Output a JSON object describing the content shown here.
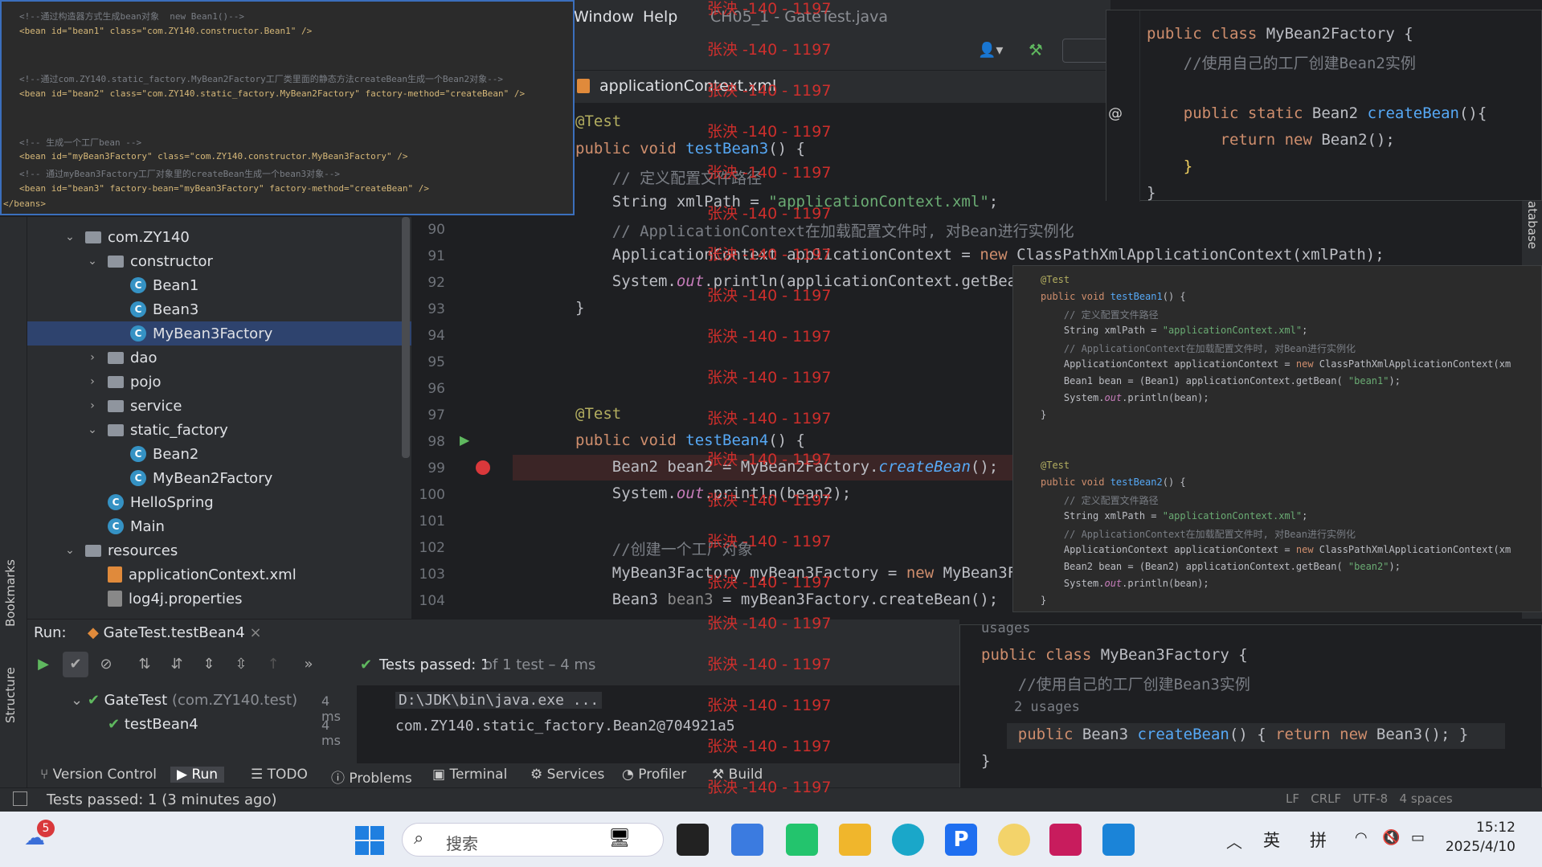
{
  "menubar": {
    "window": "Window",
    "help": "Help",
    "title": "CH05_1 - GateTest.java"
  },
  "editor_tab": {
    "label": "applicationContext.xml"
  },
  "watermark": "张泱 -140 - 1197",
  "xml_popup": {
    "lines": [
      "<!--通过构造器方式生成bean对象  new Bean1()-->",
      "<bean id=\"bean1\" class=\"com.ZY140.constructor.Bean1\" />",
      "",
      "",
      "<!--通过com.ZY140.static_factory.MyBean2Factory工厂类里面的静态方法createBean生成一个Bean2对象-->",
      "<bean id=\"bean2\" class=\"com.ZY140.static_factory.MyBean2Factory\" factory-method=\"createBean\" />",
      "",
      "",
      "<!-- 生成一个工厂bean -->",
      "<bean id=\"myBean3Factory\" class=\"com.ZY140.constructor.MyBean3Factory\" />",
      "<!-- 通过myBean3Factory工厂对象里的createBean生成一个bean3对象-->",
      "<bean id=\"bean3\" factory-bean=\"myBean3Factory\" factory-method=\"createBean\" />",
      "</beans>"
    ]
  },
  "project_tree": [
    {
      "label": "com.ZY140",
      "indent": 1,
      "kind": "folder",
      "open": true
    },
    {
      "label": "constructor",
      "indent": 2,
      "kind": "folder",
      "open": true
    },
    {
      "label": "Bean1",
      "indent": 3,
      "kind": "class"
    },
    {
      "label": "Bean3",
      "indent": 3,
      "kind": "class"
    },
    {
      "label": "MyBean3Factory",
      "indent": 3,
      "kind": "class",
      "selected": true
    },
    {
      "label": "dao",
      "indent": 2,
      "kind": "folder",
      "open": false
    },
    {
      "label": "pojo",
      "indent": 2,
      "kind": "folder",
      "open": false
    },
    {
      "label": "service",
      "indent": 2,
      "kind": "folder",
      "open": false
    },
    {
      "label": "static_factory",
      "indent": 2,
      "kind": "folder",
      "open": true
    },
    {
      "label": "Bean2",
      "indent": 3,
      "kind": "class"
    },
    {
      "label": "MyBean2Factory",
      "indent": 3,
      "kind": "class"
    },
    {
      "label": "HelloSpring",
      "indent": 2,
      "kind": "class"
    },
    {
      "label": "Main",
      "indent": 2,
      "kind": "class"
    },
    {
      "label": "resources",
      "indent": 1,
      "kind": "folder",
      "open": true
    },
    {
      "label": "applicationContext.xml",
      "indent": 2,
      "kind": "xml"
    },
    {
      "label": "log4j.properties",
      "indent": 2,
      "kind": "props"
    }
  ],
  "line_numbers": [
    "90",
    "91",
    "92",
    "93",
    "94",
    "95",
    "96",
    "97",
    "98",
    "99",
    "100",
    "101",
    "102",
    "103",
    "104"
  ],
  "b2f": {
    "lines": [
      "public class MyBean2Factory {",
      "    //使用自己的工厂创建Bean2实例",
      "",
      "    public static Bean2 createBean(){",
      "        return new Bean2();",
      "    }",
      "}"
    ]
  },
  "run": {
    "label": "Run:",
    "tab": "GateTest.testBean4",
    "passed": "Tests passed: 1",
    "of": " of 1 test – 4 ms",
    "tree": [
      {
        "label": "GateTest",
        "pkg": " (com.ZY140.test)",
        "time": "4 ms"
      },
      {
        "label": "testBean4",
        "time": "4 ms"
      }
    ],
    "console": [
      "D:\\JDK\\bin\\java.exe ...",
      "com.ZY140.static_factory.Bean2@704921a5"
    ]
  },
  "b3f": {
    "lines": [
      "public class MyBean3Factory {",
      "    //使用自己的工厂创建Bean3实例",
      "    2 usages",
      "    public Bean3 createBean() { return new Bean3(); }",
      "}"
    ],
    "header": "usages"
  },
  "bottom_tabs": [
    "Version Control",
    "Run",
    "TODO",
    "Problems",
    "Terminal",
    "Services",
    "Profiler",
    "Build"
  ],
  "left_tabs": {
    "bookmarks": "Bookmarks",
    "structure": "Structure"
  },
  "right_tab": "atabase",
  "status": {
    "text": "Tests passed: 1 (3 minutes ago)",
    "right": "LF   CRLF   UTF-8   4 spaces"
  },
  "taskbar": {
    "search_placeholder": "搜索",
    "time": "15:12",
    "date": "2025/4/10",
    "ime1": "英",
    "ime2": "拼",
    "badge": "5"
  }
}
